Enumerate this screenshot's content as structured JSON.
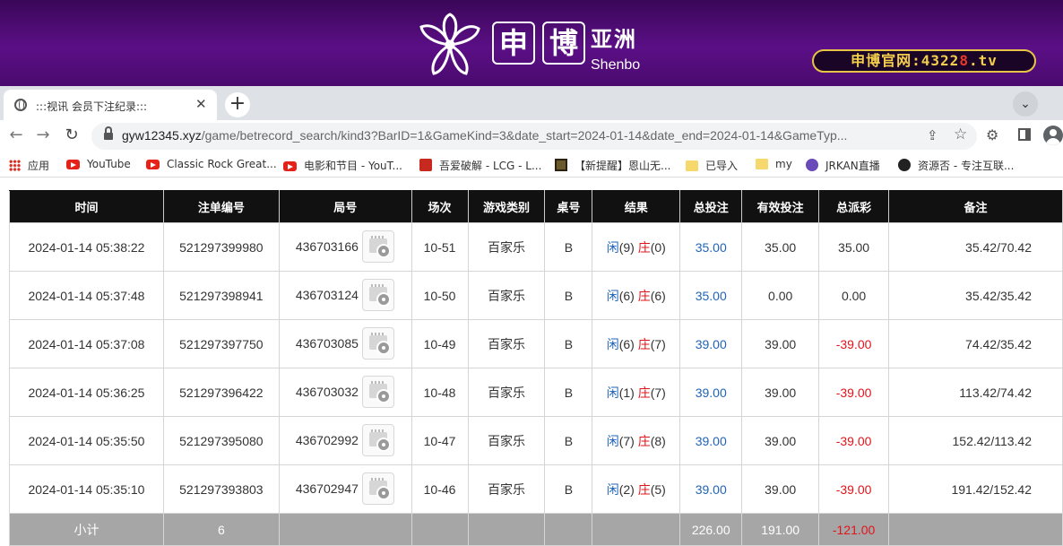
{
  "banner": {
    "brand_box1": "申",
    "brand_box2": "博",
    "brand_cn": "亚洲",
    "brand_en": "Shenbo",
    "site_prefix": "申博官网:",
    "site_num": "4322",
    "site_red": "8",
    "site_suffix": ".tv"
  },
  "browser": {
    "tab_title": ":::视讯 会员下注纪录:::",
    "url_host": "gyw12345.xyz",
    "url_path": "/game/betrecord_search/kind3?BarID=1&GameKind=3&date_start=2024-01-14&date_end=2024-01-14&GameTyp...",
    "bookmarks": [
      {
        "label": "应用",
        "icon": "apps-icon"
      },
      {
        "label": "YouTube",
        "icon": "youtube-icon"
      },
      {
        "label": "Classic Rock Great...",
        "icon": "youtube-icon"
      },
      {
        "label": "电影和节目 - YouT...",
        "icon": "youtube-icon"
      },
      {
        "label": "吾爱破解 - LCG - L...",
        "icon": "lcg-icon"
      },
      {
        "label": "【新提醒】恩山无...",
        "icon": "film-icon"
      },
      {
        "label": "已导入",
        "icon": "folder-icon"
      },
      {
        "label": "my",
        "icon": "folder-icon"
      },
      {
        "label": "JRKAN直播",
        "icon": "jrkan-icon"
      },
      {
        "label": "资源否 - 专注互联...",
        "icon": "ziyuanfou-icon"
      }
    ]
  },
  "table": {
    "headers": [
      "时间",
      "注单编号",
      "局号",
      "场次",
      "游戏类别",
      "桌号",
      "结果",
      "总投注",
      "有效投注",
      "总派彩",
      "备注"
    ],
    "rows": [
      {
        "time": "2024-01-14 05:38:22",
        "bet_id": "521297399980",
        "round": "436703166",
        "session": "10-51",
        "game": "百家乐",
        "table": "B",
        "player_label": "闲",
        "player_score": "(9)",
        "banker_label": "庄",
        "banker_score": "(0)",
        "total": "35.00",
        "valid": "35.00",
        "payout": "35.00",
        "payout_negative": false,
        "note": "35.42/70.42"
      },
      {
        "time": "2024-01-14 05:37:48",
        "bet_id": "521297398941",
        "round": "436703124",
        "session": "10-50",
        "game": "百家乐",
        "table": "B",
        "player_label": "闲",
        "player_score": "(6)",
        "banker_label": "庄",
        "banker_score": "(6)",
        "total": "35.00",
        "valid": "0.00",
        "payout": "0.00",
        "payout_negative": false,
        "note": "35.42/35.42"
      },
      {
        "time": "2024-01-14 05:37:08",
        "bet_id": "521297397750",
        "round": "436703085",
        "session": "10-49",
        "game": "百家乐",
        "table": "B",
        "player_label": "闲",
        "player_score": "(6)",
        "banker_label": "庄",
        "banker_score": "(7)",
        "total": "39.00",
        "valid": "39.00",
        "payout": "-39.00",
        "payout_negative": true,
        "note": "74.42/35.42"
      },
      {
        "time": "2024-01-14 05:36:25",
        "bet_id": "521297396422",
        "round": "436703032",
        "session": "10-48",
        "game": "百家乐",
        "table": "B",
        "player_label": "闲",
        "player_score": "(1)",
        "banker_label": "庄",
        "banker_score": "(7)",
        "total": "39.00",
        "valid": "39.00",
        "payout": "-39.00",
        "payout_negative": true,
        "note": "113.42/74.42"
      },
      {
        "time": "2024-01-14 05:35:50",
        "bet_id": "521297395080",
        "round": "436702992",
        "session": "10-47",
        "game": "百家乐",
        "table": "B",
        "player_label": "闲",
        "player_score": "(7)",
        "banker_label": "庄",
        "banker_score": "(8)",
        "total": "39.00",
        "valid": "39.00",
        "payout": "-39.00",
        "payout_negative": true,
        "note": "152.42/113.42"
      },
      {
        "time": "2024-01-14 05:35:10",
        "bet_id": "521297393803",
        "round": "436702947",
        "session": "10-46",
        "game": "百家乐",
        "table": "B",
        "player_label": "闲",
        "player_score": "(2)",
        "banker_label": "庄",
        "banker_score": "(5)",
        "total": "39.00",
        "valid": "39.00",
        "payout": "-39.00",
        "payout_negative": true,
        "note": "191.42/152.42"
      }
    ],
    "subtotal": {
      "label": "小计",
      "count": "6",
      "total": "226.00",
      "valid": "191.00",
      "payout": "-121.00"
    }
  },
  "colors": {
    "banner_purple": "#5b0f86",
    "header_black": "#111111",
    "positive_blue": "#1f63b8",
    "negative_red": "#e0151b",
    "subtotal_gray": "#a6a6a6"
  }
}
